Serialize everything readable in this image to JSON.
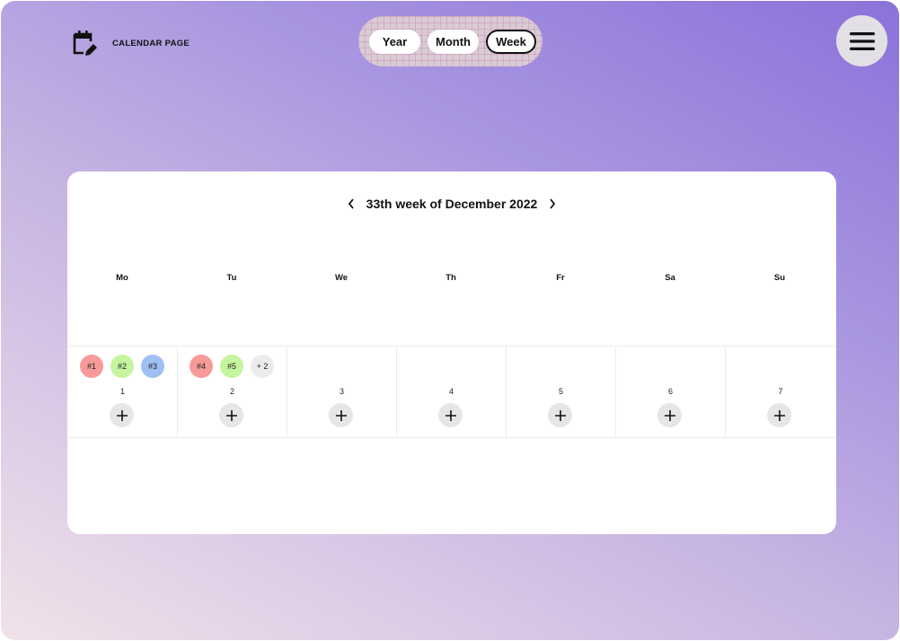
{
  "header": {
    "logo_text": "CALENDAR PAGE",
    "logo_icon": "calendar-edit-icon",
    "menu_icon": "hamburger-menu-icon"
  },
  "view_switcher": {
    "options": [
      "Year",
      "Month",
      "Week"
    ],
    "selected": "Week"
  },
  "calendar": {
    "title": "33th week of December 2022",
    "prev_icon": "chevron-left-icon",
    "next_icon": "chevron-right-icon",
    "weekdays": [
      "Mo",
      "Tu",
      "We",
      "Th",
      "Fr",
      "Sa",
      "Su"
    ],
    "days": [
      {
        "number": "1",
        "events": [
          {
            "label": "#1",
            "color": "#f69a9a"
          },
          {
            "label": "#2",
            "color": "#c5f59e"
          },
          {
            "label": "#3",
            "color": "#9fc0f4"
          }
        ]
      },
      {
        "number": "2",
        "events": [
          {
            "label": "#4",
            "color": "#f69a9a"
          },
          {
            "label": "#5",
            "color": "#c5f59e"
          },
          {
            "label": "+ 2",
            "color": "#ececec"
          }
        ]
      },
      {
        "number": "3",
        "events": []
      },
      {
        "number": "4",
        "events": []
      },
      {
        "number": "5",
        "events": []
      },
      {
        "number": "6",
        "events": []
      },
      {
        "number": "7",
        "events": []
      }
    ],
    "add_icon": "plus-icon"
  },
  "colors": {
    "event_red": "#f69a9a",
    "event_green": "#c5f59e",
    "event_blue": "#9fc0f4",
    "more_grey": "#ececec"
  }
}
